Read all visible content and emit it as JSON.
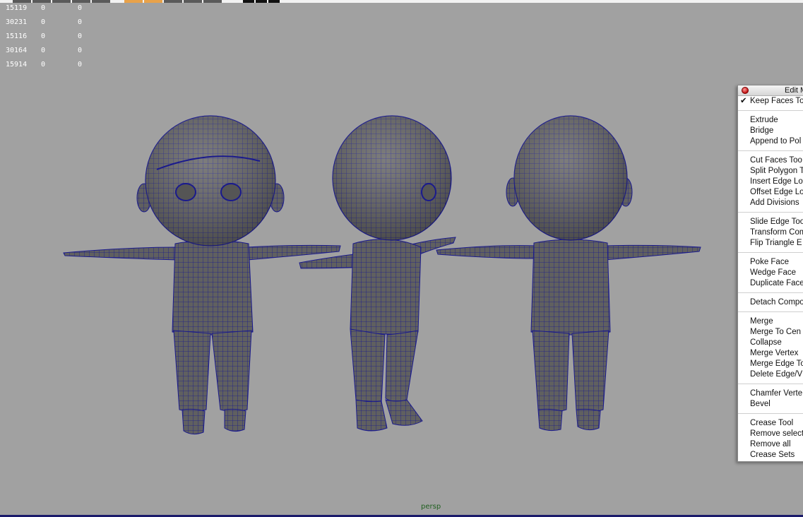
{
  "stats": {
    "rows": [
      [
        "15119",
        "0",
        "0"
      ],
      [
        "30231",
        "0",
        "0"
      ],
      [
        "15116",
        "0",
        "0"
      ],
      [
        "30164",
        "0",
        "0"
      ],
      [
        "15914",
        "0",
        "0"
      ]
    ]
  },
  "viewport": {
    "camera_label": "persp"
  },
  "menu": {
    "title": "Edit M",
    "keep_faces": {
      "label": "Keep Faces To",
      "checked": true
    },
    "groups": [
      [
        "Extrude",
        "Bridge",
        "Append to Pol"
      ],
      [
        "Cut Faces Too",
        "Split Polygon T",
        "Insert Edge Lo",
        "Offset Edge Lo",
        "Add Divisions"
      ],
      [
        "Slide Edge Too",
        "Transform Com",
        "Flip Triangle E"
      ],
      [
        "Poke Face",
        "Wedge Face",
        "Duplicate Face"
      ],
      [
        "Detach Compo"
      ],
      [
        "Merge",
        "Merge To Cen",
        "Collapse",
        "Merge Vertex",
        "Merge Edge To",
        "Delete Edge/V"
      ],
      [
        "Chamfer Verte",
        "Bevel"
      ],
      [
        "Crease Tool",
        "Remove select",
        "Remove all",
        "Crease Sets"
      ]
    ]
  },
  "colors": {
    "viewport_bg": "#a1a1a1",
    "mesh_fill": "#5f5f5f",
    "wireframe": "#1a1a8c"
  }
}
